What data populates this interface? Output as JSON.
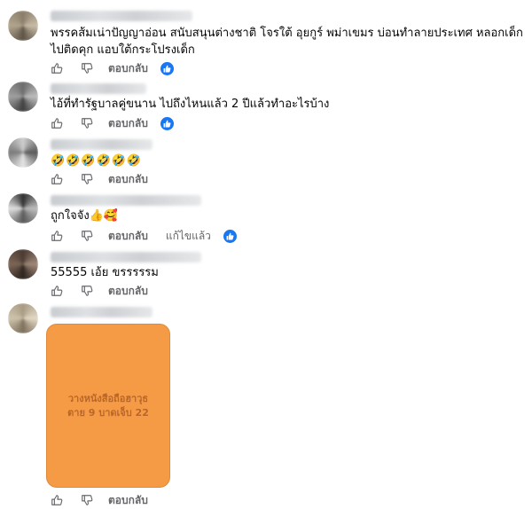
{
  "comments": [
    {
      "text_line1": "พรรคส้มเน่าปัญญาอ่อน สนับสนุนต่างชาติ โจรใต้ อุยกูร์ พม่าเขมร บ่อนทำลายประเทศ หลอกเด็ก",
      "text_line2": "ไปติดคุก แอบใต้กระโปรงเด็ก",
      "reply_label": "ตอบกลับ",
      "reaction_icon": "like-icon"
    },
    {
      "text_line1": "ไอ้ที่ทำรัฐบาลคู่ขนาน ไปถึงไหนแล้ว 2 ปีแล้วทำอะไรบ้าง",
      "reply_label": "ตอบกลับ",
      "reaction_icon": "like-icon"
    },
    {
      "text_line1": "🤣🤣🤣🤣🤣🤣",
      "reply_label": "ตอบกลับ"
    },
    {
      "text_line1": "ถูกใจจัง👍🥰",
      "reply_label": "ตอบกลับ",
      "edited_label": "แก้ไขแล้ว",
      "reaction_icon": "like-icon"
    },
    {
      "text_line1": "55555 เอ้ย ขรรรรรม",
      "reply_label": "ตอบกลับ"
    },
    {
      "sticker_line1": "วางหนังสือถือฮาวุธ",
      "sticker_line2": "ตาย 9 บาดเจ็บ 22",
      "reply_label": "ตอบกลับ"
    }
  ],
  "colors": {
    "reaction_blue": "#1877f2",
    "sticker_orange": "#f58a25",
    "meta_gray": "#65676b"
  }
}
